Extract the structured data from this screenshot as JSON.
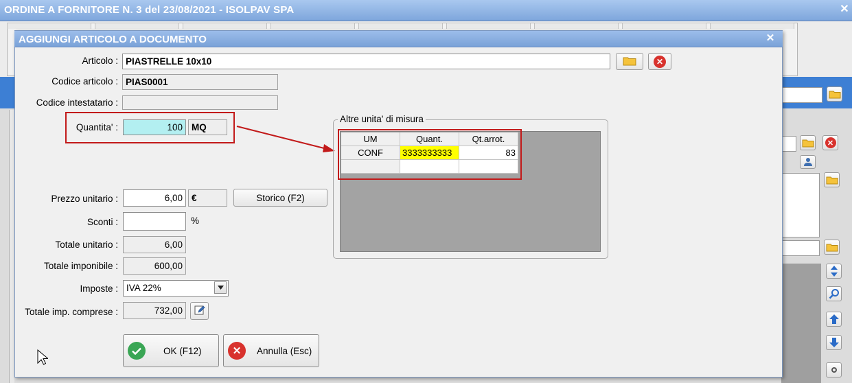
{
  "background_window": {
    "title": "ORDINE A FORNITORE N. 3 del 23/08/2021 - ISOLPAV SPA",
    "close_glyph": "✕"
  },
  "dialog": {
    "title": "AGGIUNGI ARTICOLO A DOCUMENTO",
    "close_glyph": "✕",
    "fields": {
      "articolo": {
        "label": "Articolo :",
        "value": "PIASTRELLE 10x10"
      },
      "codice_articolo": {
        "label": "Codice articolo :",
        "value": "PIAS0001"
      },
      "codice_intestatario": {
        "label": "Codice intestatario :",
        "value": ""
      },
      "quantita": {
        "label": "Quantita' :",
        "value": "100",
        "um": "MQ"
      },
      "prezzo_unitario": {
        "label": "Prezzo unitario :",
        "value": "6,00",
        "currency": "€"
      },
      "sconti": {
        "label": "Sconti :",
        "value": "",
        "unit": "%"
      },
      "totale_unitario": {
        "label": "Totale unitario :",
        "value": "6,00"
      },
      "totale_imponibile": {
        "label": "Totale imponibile :",
        "value": "600,00"
      },
      "imposte": {
        "label": "Imposte :",
        "value": "IVA 22%"
      },
      "totale_imp_comprese": {
        "label": "Totale imp. comprese :",
        "value": "732,00"
      }
    },
    "storico_button": "Storico (F2)",
    "altre_unita": {
      "group_label": "Altre unita' di misura",
      "columns": [
        "UM",
        "Quant.",
        "Qt.arrot."
      ],
      "rows": [
        [
          "CONF",
          "3333333333",
          "83"
        ],
        [
          "",
          "",
          ""
        ]
      ]
    },
    "ok_button": "OK (F12)",
    "annulla_button": "Annulla (Esc)"
  },
  "icons": {
    "folder": "folder-icon",
    "delete": "delete-icon",
    "edit": "edit-icon",
    "ok": "check-icon",
    "cancel": "cancel-icon"
  },
  "colors": {
    "highlight_red": "#c21a1a",
    "quantity_cyan": "#b3eff1",
    "cell_yellow": "#ffff00",
    "title_blue": "#7aa2d8",
    "background_blue": "#3d7fd4"
  }
}
